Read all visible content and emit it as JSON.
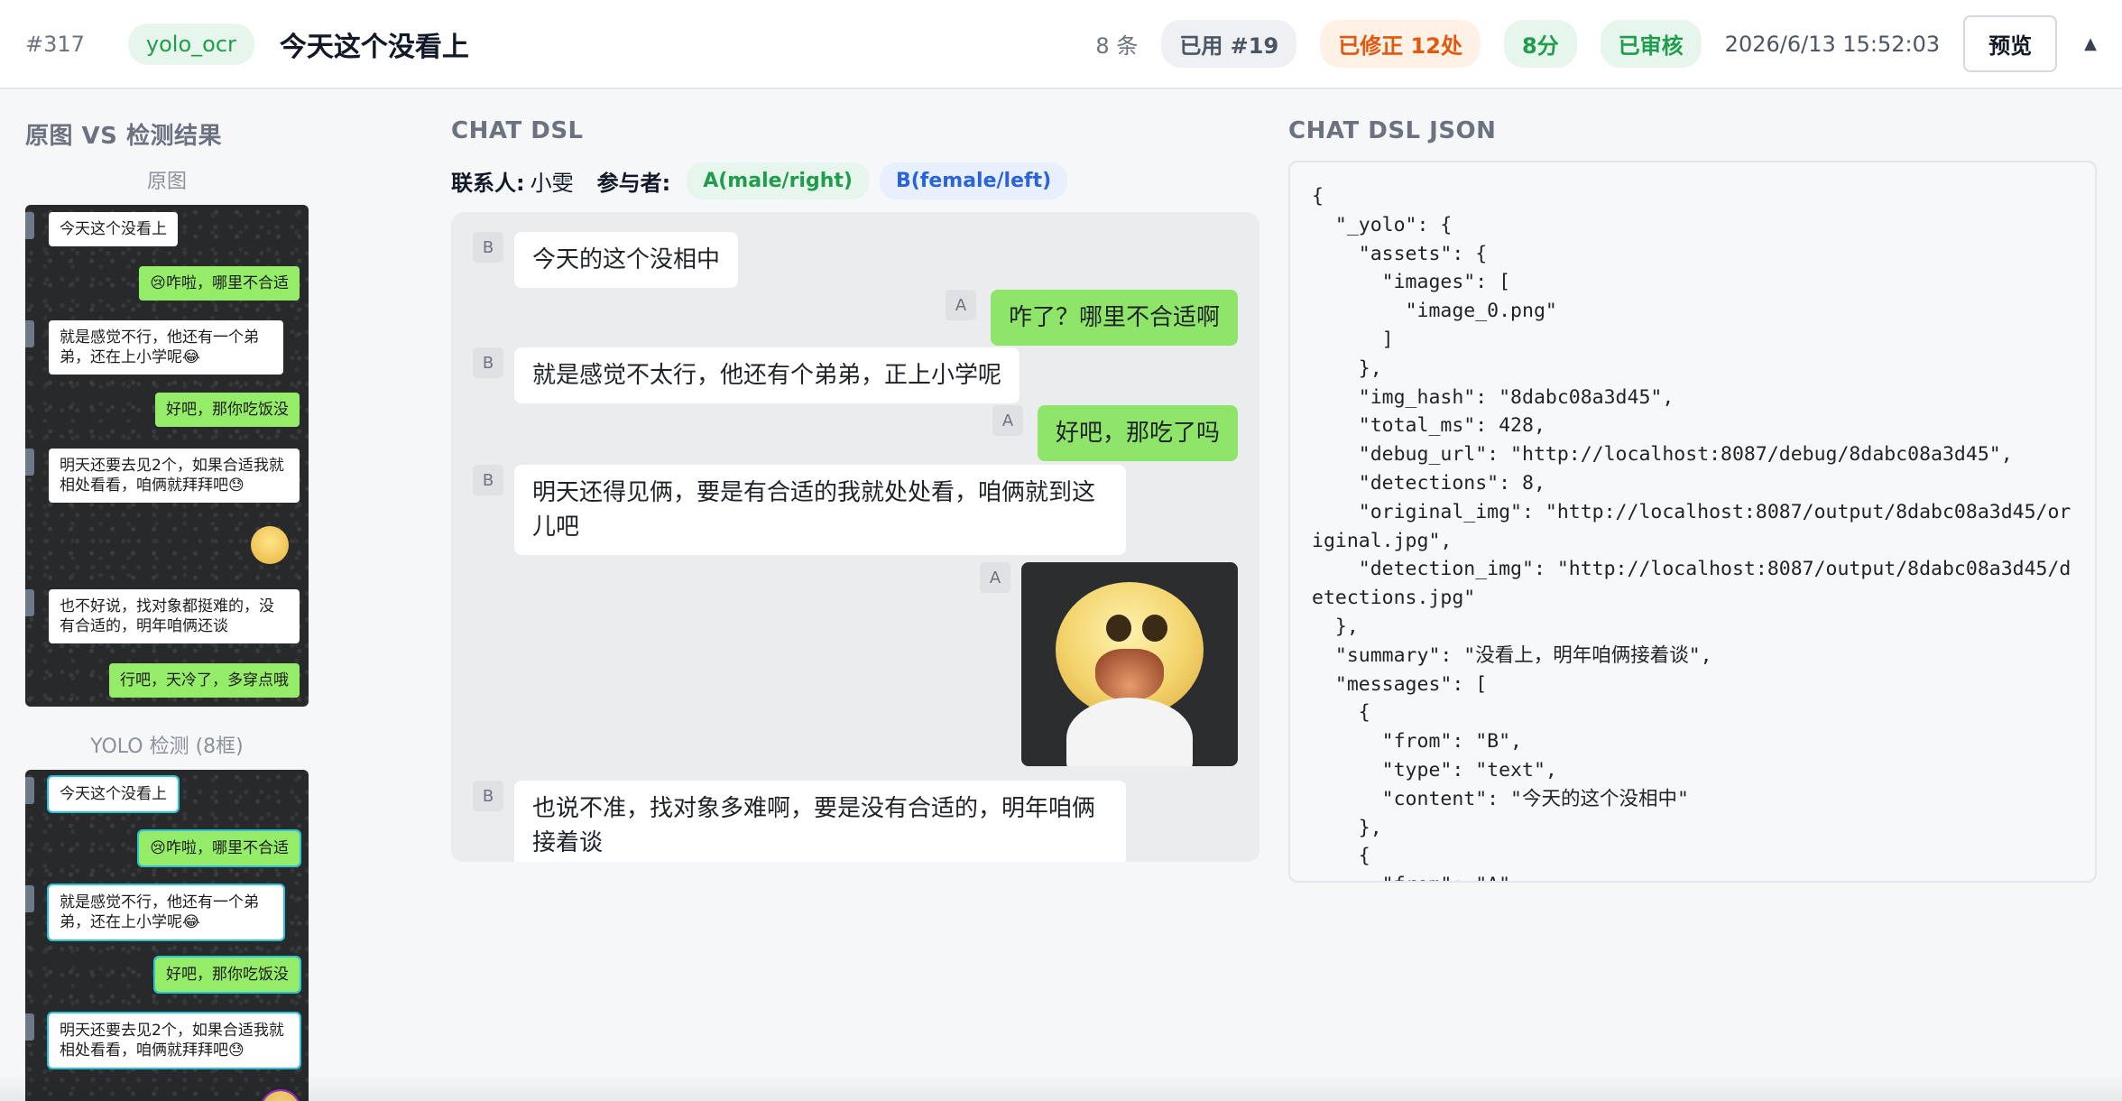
{
  "header": {
    "id": "#317",
    "source_tag": "yolo_ocr",
    "title": "今天这个没看上",
    "count": "8 条",
    "used": "已用 #19",
    "corrected": "已修正 12处",
    "score": "8分",
    "status": "已审核",
    "datetime": "2026/6/13 15:52:03",
    "preview_label": "预览",
    "collapse_icon": "▲"
  },
  "left": {
    "section_title": "原图 VS 检测结果",
    "original_caption": "原图",
    "detection_caption": "YOLO 检测 (8框)",
    "original_msgs": [
      "今天这个没看上",
      "😢咋啦，哪里不合适",
      "就是感觉不行，他还有一个弟弟，还在上小学呢😂",
      "好吧，那你吃饭没",
      "明天还要去见2个，如果合适我就相处看看，咱俩就拜拜吧😓",
      "也不好说，找对象都挺难的，没有合适的，明年咱俩还谈",
      "行吧，天冷了，多穿点哦"
    ],
    "detection_msgs": [
      "今天这个没看上",
      "😢咋啦，哪里不合适",
      "就是感觉不行，他还有一个弟弟，还在上小学呢😂",
      "好吧，那你吃饭没",
      "明天还要去见2个，如果合适我就相处看看，咱俩就拜拜吧😓"
    ]
  },
  "chat": {
    "section_title": "CHAT DSL",
    "contact_label": "联系人:",
    "contact_name": "小雯",
    "participants_label": "参与者:",
    "participant_a": "A(male/right)",
    "participant_b": "B(female/left)",
    "messages": [
      {
        "from": "B",
        "type": "text",
        "content": "今天的这个没相中"
      },
      {
        "from": "A",
        "type": "text",
        "content": "咋了？哪里不合适啊"
      },
      {
        "from": "B",
        "type": "text",
        "content": "就是感觉不太行，他还有个弟弟，正上小学呢"
      },
      {
        "from": "A",
        "type": "text",
        "content": "好吧，那吃了吗"
      },
      {
        "from": "B",
        "type": "text",
        "content": "明天还得见俩，要是有合适的我就处处看，咱俩就到这儿吧"
      },
      {
        "from": "A",
        "type": "image",
        "content": "crying-face-sticker"
      },
      {
        "from": "B",
        "type": "text",
        "content": "也说不准，找对象多难啊，要是没有合适的，明年咱俩接着谈"
      }
    ]
  },
  "json_panel": {
    "section_title": "CHAT DSL JSON",
    "text": "{\n  \"_yolo\": {\n    \"assets\": {\n      \"images\": [\n        \"image_0.png\"\n      ]\n    },\n    \"img_hash\": \"8dabc08a3d45\",\n    \"total_ms\": 428,\n    \"debug_url\": \"http://localhost:8087/debug/8dabc08a3d45\",\n    \"detections\": 8,\n    \"original_img\": \"http://localhost:8087/output/8dabc08a3d45/original.jpg\",\n    \"detection_img\": \"http://localhost:8087/output/8dabc08a3d45/detections.jpg\"\n  },\n  \"summary\": \"没看上，明年咱俩接着谈\",\n  \"messages\": [\n    {\n      \"from\": \"B\",\n      \"type\": \"text\",\n      \"content\": \"今天的这个没相中\"\n    },\n    {\n      \"from\": \"A\","
  },
  "colors": {
    "accent_green": "#1f9d4c",
    "accent_orange": "#e0590f",
    "accent_blue": "#2b63d9",
    "bubble_green": "#8ee56a",
    "detection_box": "#2ac4d6"
  }
}
